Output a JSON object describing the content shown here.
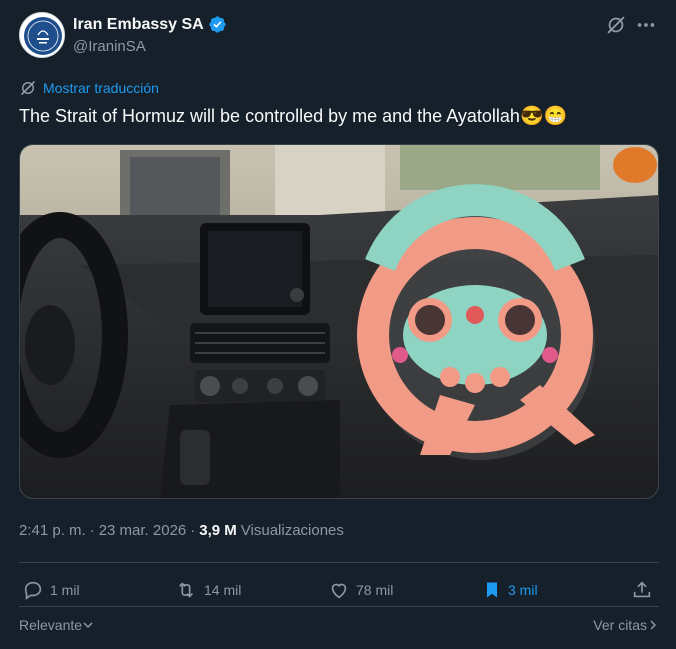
{
  "author": {
    "display_name": "Iran Embassy SA",
    "handle": "@IraninSA"
  },
  "tweet": {
    "translate_label": "Mostrar traducción",
    "text": "The Strait of Hormuz will be controlled by me and the Ayatollah",
    "emojis": "😎😁",
    "time": "2:41 p. m.",
    "date": "23 mar. 2026",
    "separator": "·",
    "views_count": "3,9 M",
    "views_label": "Visualizaciones"
  },
  "actions": {
    "replies": "1 mil",
    "reposts": "14 mil",
    "likes": "78 mil",
    "bookmarks": "3 mil"
  },
  "footer": {
    "sort_label": "Relevante",
    "quotes_label": "Ver citas"
  },
  "colors": {
    "background": "#15202b",
    "accent": "#1d9bf0",
    "muted": "#8b98a5",
    "border": "#38444d"
  }
}
